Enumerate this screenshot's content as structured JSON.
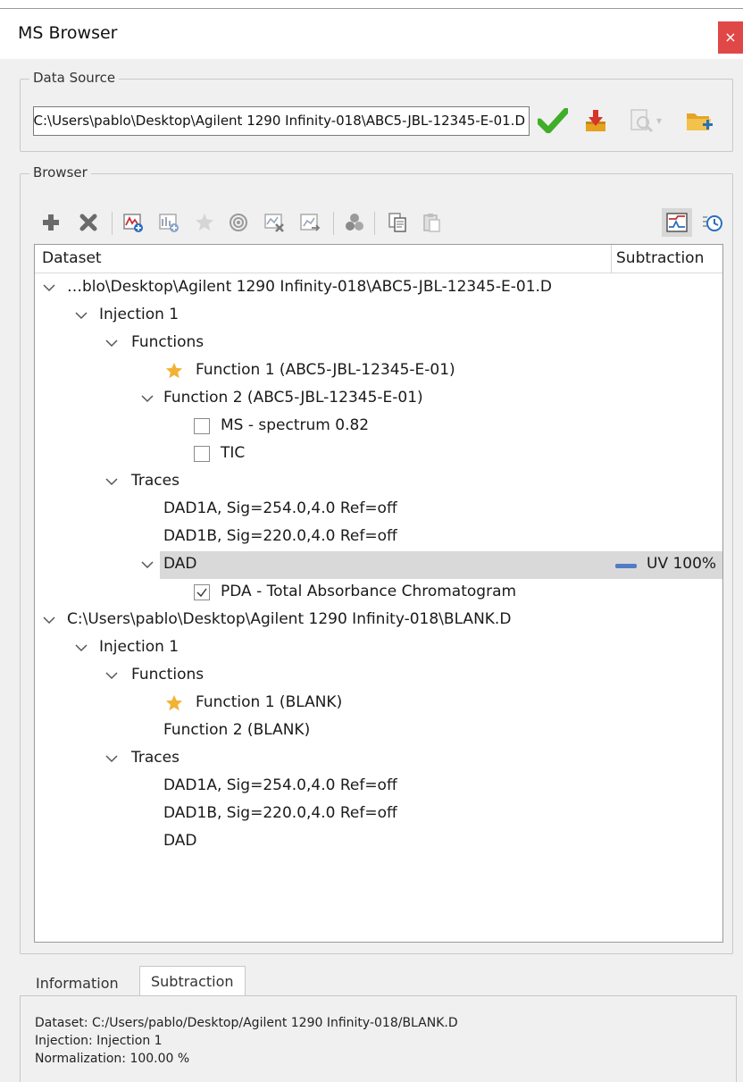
{
  "window": {
    "title": "MS Browser",
    "close_label": "×"
  },
  "data_source": {
    "group_title": "Data Source",
    "path_value": "C:\\Users\\pablo\\Desktop\\Agilent 1290 Infinity-018\\ABC5-JBL-12345-E-01.D",
    "icons": [
      "check-icon",
      "import-icon",
      "preview-icon",
      "open-folder-icon"
    ],
    "dropdown_glyph": "▾"
  },
  "browser": {
    "group_title": "Browser",
    "toolbar_icons": [
      "add-icon",
      "remove-icon",
      "add-spectrum-icon",
      "add-function-icon",
      "star-icon",
      "target-icon",
      "clear-icon",
      "export-icon",
      "group-icon",
      "copy-icon",
      "paste-icon",
      "chart-view-icon",
      "time-view-icon"
    ],
    "columns": {
      "dataset": "Dataset",
      "subtraction": "Subtraction"
    },
    "tree": [
      {
        "label": "…blo\\Desktop\\Agilent 1290 Infinity-018\\ABC5-JBL-12345-E-01.D",
        "expanded": true
      },
      {
        "label": "Injection 1",
        "expanded": true
      },
      {
        "label": "Functions",
        "expanded": true
      },
      {
        "label": "Function 1 (ABC5-JBL-12345-E-01)",
        "starred": true
      },
      {
        "label": "Function 2 (ABC5-JBL-12345-E-01)",
        "expanded": true
      },
      {
        "label": "MS - spectrum 0.82",
        "checked": false
      },
      {
        "label": "TIC",
        "checked": false
      },
      {
        "label": "Traces",
        "expanded": true
      },
      {
        "label": "DAD1A, Sig=254.0,4.0  Ref=off"
      },
      {
        "label": "DAD1B, Sig=220.0,4.0  Ref=off"
      },
      {
        "label": "DAD",
        "expanded": true,
        "selected": true,
        "subtraction": "UV 100%"
      },
      {
        "label": "PDA - Total Absorbance Chromatogram",
        "checked": true
      },
      {
        "label": "C:\\Users\\pablo\\Desktop\\Agilent 1290 Infinity-018\\BLANK.D",
        "expanded": true
      },
      {
        "label": "Injection 1",
        "expanded": true
      },
      {
        "label": "Functions",
        "expanded": true
      },
      {
        "label": "Function 1 (BLANK)",
        "starred": true
      },
      {
        "label": "Function 2 (BLANK)"
      },
      {
        "label": "Traces",
        "expanded": true
      },
      {
        "label": "DAD1A, Sig=254.0,4.0  Ref=off"
      },
      {
        "label": "DAD1B, Sig=220.0,4.0  Ref=off"
      },
      {
        "label": "DAD"
      }
    ]
  },
  "tabs": [
    {
      "label": "Information",
      "active": false
    },
    {
      "label": "Subtraction",
      "active": true
    }
  ],
  "info": {
    "dataset": "Dataset: C:/Users/pablo/Desktop/Agilent 1290 Infinity-018/BLANK.D",
    "injection": "Injection: Injection 1",
    "normalization": "Normalization: 100.00 %"
  },
  "colors": {
    "close_bg": "#e04848",
    "check": "#3fae2a",
    "star": "#f2b233",
    "uv_bar": "#4f7cc4",
    "selection": "#d9d9d9"
  }
}
